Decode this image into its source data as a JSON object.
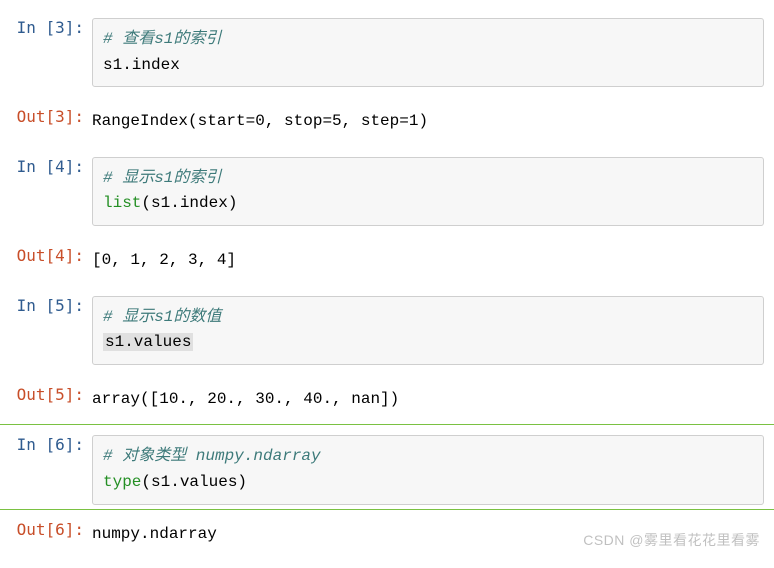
{
  "cells": [
    {
      "in_prompt": "In  [3]:",
      "comment": "# 查看s1的索引",
      "code_plain": "s1.index",
      "out_prompt": "Out[3]:",
      "output": "RangeIndex(start=0, stop=5, step=1)"
    },
    {
      "in_prompt": "In  [4]:",
      "comment": "# 显示s1的索引",
      "builtin": "list",
      "args": "(s1.index)",
      "out_prompt": "Out[4]:",
      "output": "[0, 1, 2, 3, 4]"
    },
    {
      "in_prompt": "In  [5]:",
      "comment": "# 显示s1的数值",
      "code_highlight": "s1.values",
      "out_prompt": "Out[5]:",
      "output": "array([10., 20., 30., 40., nan])"
    },
    {
      "in_prompt": "In  [6]:",
      "comment": "# 对象类型 numpy.ndarray",
      "builtin": "type",
      "args": "(s1.values)",
      "out_prompt": "Out[6]:",
      "output": "numpy.ndarray",
      "selected": true
    }
  ],
  "watermark": "CSDN @雾里看花花里看雾"
}
